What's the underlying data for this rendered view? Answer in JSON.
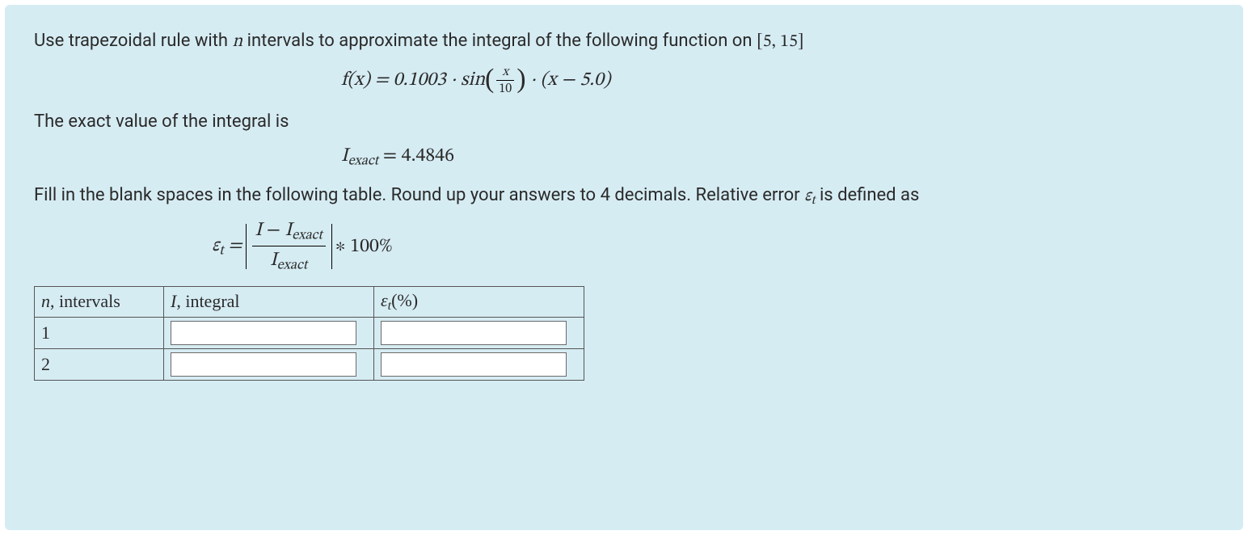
{
  "problem": {
    "intro_pre": "Use trapezoidal rule with ",
    "intro_var": "n",
    "intro_mid": " intervals to approximate the integral of the following function on ",
    "interval": "[5, 15]",
    "fx_lhs": "f(x) = 0.1003 · sin",
    "fx_frac_num": "x",
    "fx_frac_den": "10",
    "fx_rhs": " · (x − 5.0)",
    "exact_label": "The exact value of the integral is",
    "Iexact_sym_I": "I",
    "Iexact_sym_sub": "exact",
    "Iexact_eq": " = 4.4846",
    "fill_pre": "Fill in the blank spaces in the following table. Round up your answers to 4 decimals. Relative error ",
    "eps_sym": "ε",
    "eps_sub": "t",
    "fill_post": " is defined as",
    "err_times": " ∗ 100%",
    "table": {
      "col_n_pre": "n",
      "col_n_post": ", intervals",
      "col_I_pre": "I",
      "col_I_post": ", integral",
      "col_e_pre": "ε",
      "col_e_sub": "t",
      "col_e_post": "(%)",
      "rows": [
        {
          "n": "1",
          "I": "",
          "e": ""
        },
        {
          "n": "2",
          "I": "",
          "e": ""
        }
      ]
    }
  }
}
